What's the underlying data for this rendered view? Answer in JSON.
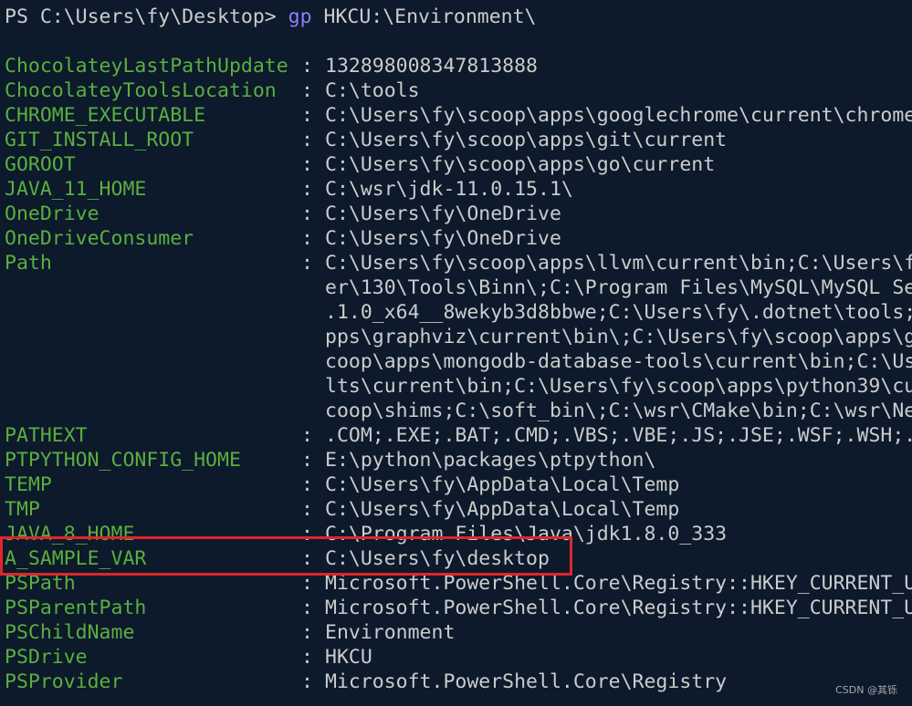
{
  "prompt": {
    "path": "PS C:\\Users\\fy\\Desktop> ",
    "command": "gp",
    "argument": " HKCU:\\Environment\\"
  },
  "separator": ":",
  "rows": [
    {
      "key": "ChocolateyLastPathUpdate",
      "value": "132898008347813888"
    },
    {
      "key": "ChocolateyToolsLocation",
      "value": "C:\\tools"
    },
    {
      "key": "CHROME_EXECUTABLE",
      "value": "C:\\Users\\fy\\scoop\\apps\\googlechrome\\current\\chrome"
    },
    {
      "key": "GIT_INSTALL_ROOT",
      "value": "C:\\Users\\fy\\scoop\\apps\\git\\current"
    },
    {
      "key": "GOROOT",
      "value": "C:\\Users\\fy\\scoop\\apps\\go\\current"
    },
    {
      "key": "JAVA_11_HOME",
      "value": "C:\\wsr\\jdk-11.0.15.1\\"
    },
    {
      "key": "OneDrive",
      "value": "C:\\Users\\fy\\OneDrive"
    },
    {
      "key": "OneDriveConsumer",
      "value": "C:\\Users\\fy\\OneDrive"
    },
    {
      "key": "Path",
      "value": "C:\\Users\\fy\\scoop\\apps\\llvm\\current\\bin;C:\\Users\\f"
    },
    {
      "key": "",
      "value": "er\\130\\Tools\\Binn\\;C:\\Program Files\\MySQL\\MySQL Se"
    },
    {
      "key": "",
      "value": ".1.0_x64__8wekyb3d8bbwe;C:\\Users\\fy\\.dotnet\\tools;"
    },
    {
      "key": "",
      "value": "pps\\graphviz\\current\\bin\\;C:\\Users\\fy\\scoop\\apps\\g"
    },
    {
      "key": "",
      "value": "coop\\apps\\mongodb-database-tools\\current\\bin;C:\\Us"
    },
    {
      "key": "",
      "value": "lts\\current\\bin;C:\\Users\\fy\\scoop\\apps\\python39\\cu"
    },
    {
      "key": "",
      "value": "coop\\shims;C:\\soft_bin\\;C:\\wsr\\CMake\\bin;C:\\wsr\\Ne"
    },
    {
      "key": "PATHEXT",
      "value": ".COM;.EXE;.BAT;.CMD;.VBS;.VBE;.JS;.JSE;.WSF;.WSH;."
    },
    {
      "key": "PTPYTHON_CONFIG_HOME",
      "value": "E:\\python\\packages\\ptpython\\"
    },
    {
      "key": "TEMP",
      "value": "C:\\Users\\fy\\AppData\\Local\\Temp"
    },
    {
      "key": "TMP",
      "value": "C:\\Users\\fy\\AppData\\Local\\Temp"
    },
    {
      "key": "JAVA_8_HOME",
      "value": "C:\\Program Files\\Java\\jdk1.8.0_333"
    },
    {
      "key": "A_SAMPLE_VAR",
      "value": "C:\\Users\\fy\\desktop"
    },
    {
      "key": "PSPath",
      "value": "Microsoft.PowerShell.Core\\Registry::HKEY_CURRENT_U"
    },
    {
      "key": "PSParentPath",
      "value": "Microsoft.PowerShell.Core\\Registry::HKEY_CURRENT_U"
    },
    {
      "key": "PSChildName",
      "value": "Environment"
    },
    {
      "key": "PSDrive",
      "value": "HKCU"
    },
    {
      "key": "PSProvider",
      "value": "Microsoft.PowerShell.Core\\Registry"
    }
  ],
  "watermark": "CSDN @其铄",
  "colors": {
    "background": "#0c1a2c",
    "key": "#5cae3e",
    "value": "#cccccc",
    "command": "#8a7fff",
    "highlight": "#e0262a"
  }
}
